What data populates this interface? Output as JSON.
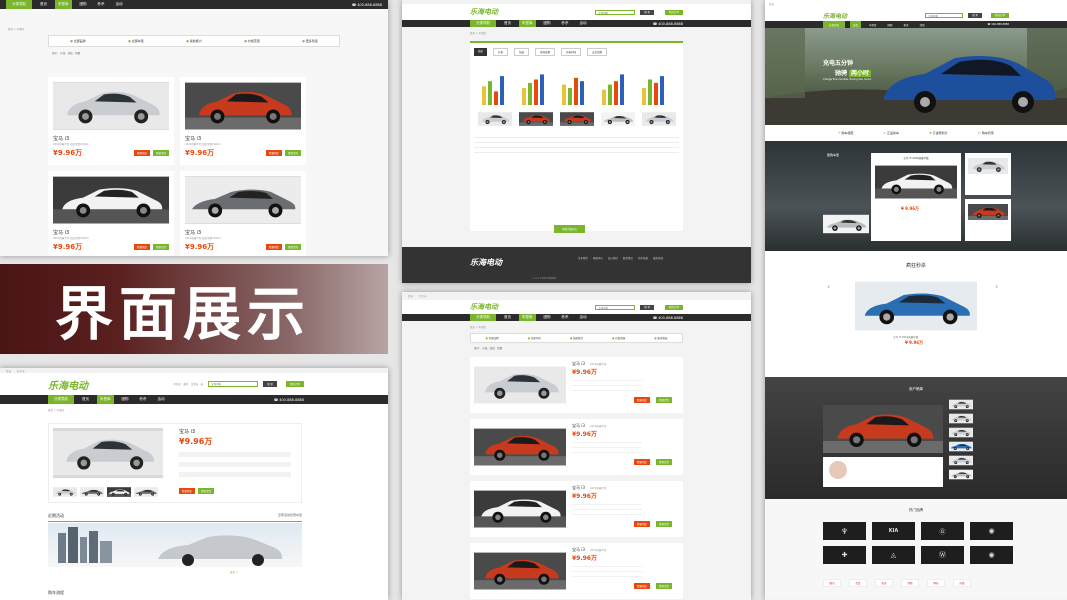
{
  "banner_title": "界面展示",
  "nav": {
    "category": "分类导航",
    "items": [
      "首页",
      "车型库",
      "团购",
      "秒杀",
      "活动"
    ],
    "phone": "400-888-8888"
  },
  "logo": "乐海电动",
  "header": {
    "search_value": "宝马i3系",
    "search_btn": "搜 索",
    "orders_btn": "我的订单",
    "hot": "特斯拉 · 腾势 · 比亚迪 · 秦"
  },
  "util": {
    "login": "登录",
    "register": "注册",
    "city": "北京市",
    "collect": "收藏本站"
  },
  "crumb": "首页 > 车型库",
  "filters": [
    "全部品牌",
    "全部车型",
    "续航能力",
    "价格范围",
    "更多筛选"
  ],
  "sort": {
    "label": "排序：",
    "items": [
      "价格",
      "续航",
      "销量"
    ]
  },
  "listing": [
    {
      "name": "宝马 i3",
      "desc": "2016款豪华型",
      "range": "续航里程200km",
      "price": "¥9.96万",
      "compare": "+ 加入对比",
      "btn1": "我要预定",
      "btn2": "我要试驾"
    },
    {
      "name": "宝马 i3",
      "desc": "2016款豪华型",
      "range": "续航里程200km",
      "price": "¥9.96万",
      "compare": "+ 加入对比",
      "btn1": "我要预定",
      "btn2": "我要试驾"
    },
    {
      "name": "宝马 i3",
      "desc": "2016款豪华型",
      "range": "续航里程200km",
      "price": "¥9.96万",
      "compare": "+ 加入对比",
      "btn1": "我要预定",
      "btn2": "我要试驾"
    },
    {
      "name": "宝马 i3",
      "desc": "2016款豪华型",
      "range": "续航里程200km",
      "price": "¥9.96万",
      "compare": "+ 加入对比",
      "btn1": "我要预定",
      "btn2": "我要试驾"
    }
  ],
  "compare": {
    "tabs": [
      "续航",
      "价格",
      "加速",
      "电池容量",
      "充电时间",
      "安全指数"
    ],
    "cta": "查看完整对比",
    "partners": [
      "腾讯",
      "百度",
      "新浪",
      "搜狐",
      "网易",
      "凤凰"
    ]
  },
  "footer": {
    "logo": "乐海电动",
    "cols": [
      "关于我们",
      "帮助中心",
      "加入我们",
      "联系我们",
      "新手指南",
      "服务条款"
    ],
    "copy": "©2016 乐海电动 版权所有"
  },
  "detail": {
    "name": "宝马 i3",
    "price": "¥9.96万",
    "desc": "2016款豪华型",
    "btn1": "我要预定",
    "btn2": "我要试驾",
    "events_title": "近期活动",
    "events_more": "更多 >",
    "section2": "购车流程",
    "event_text": "至尊活动优惠车型"
  },
  "home": {
    "hero_l1": "充电五分钟",
    "hero_l2a": "驰骋",
    "hero_l2b": "两小时",
    "hero_l3": "Charge five minutes driving two hours",
    "features": [
      "购车保障",
      "正品新车",
      "订金赠积分",
      "购车管家"
    ],
    "group_title": "团购车型",
    "group_item": "宝马 i3 2016款豪华版",
    "group_price": "¥ 9.96万",
    "seckill_title": "疯狂秒杀",
    "seckill_car": "宝马 i3 2016款豪华版",
    "seckill_price": "¥ 9.96万",
    "review_title": "用户晒单",
    "brands_title": "热门品牌",
    "brand_icons": [
      "maserati-logo",
      "kia-logo",
      "bentley-logo",
      "bmw-logo",
      "chevrolet-logo",
      "infiniti-logo",
      "volkswagen-logo",
      "bmw-logo"
    ]
  },
  "list2": [
    {
      "name": "宝马 i3",
      "desc": "2016款豪华型",
      "price": "¥9.96万",
      "btn1": "我要预定",
      "btn2": "我要试驾"
    },
    {
      "name": "宝马 i3",
      "desc": "2016款豪华型",
      "price": "¥9.96万",
      "btn1": "我要预定",
      "btn2": "我要试驾"
    },
    {
      "name": "宝马 i3",
      "desc": "2016款豪华型",
      "price": "¥9.96万",
      "btn1": "我要预定",
      "btn2": "我要试驾"
    },
    {
      "name": "宝马 i3",
      "desc": "2016款豪华型",
      "price": "¥9.96万",
      "btn1": "我要预定",
      "btn2": "我要试驾"
    }
  ],
  "chart_bars": [
    {
      "group": 1,
      "values": [
        0.55,
        0.7,
        0.4,
        0.85
      ]
    },
    {
      "group": 2,
      "values": [
        0.5,
        0.65,
        0.75,
        0.9
      ]
    },
    {
      "group": 3,
      "values": [
        0.6,
        0.5,
        0.8,
        0.7
      ]
    },
    {
      "group": 4,
      "values": [
        0.45,
        0.6,
        0.7,
        0.9
      ]
    },
    {
      "group": 5,
      "values": [
        0.5,
        0.75,
        0.65,
        0.85
      ]
    }
  ],
  "colors": {
    "accent": "#7ab52b",
    "price": "#e8480e",
    "dark": "#2b2b2b"
  }
}
